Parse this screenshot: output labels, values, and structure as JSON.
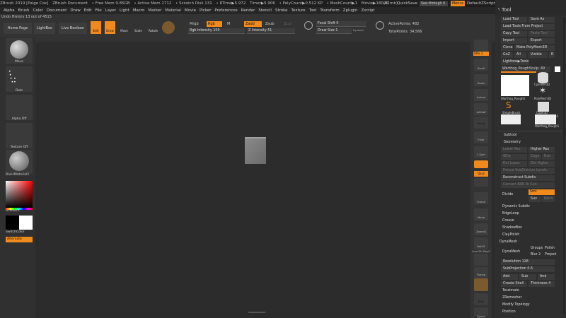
{
  "titlebar": {
    "app": "ZBrush 2019 [Paige Cox]",
    "doc": "ZBrush Document",
    "freemem": "• Free Mem 9.85GB",
    "activemem": "• Active Mem 1712",
    "scratch": "• Scratch Disk 131",
    "rtime": "• RTime▶5.972",
    "timer": "Timer▶5.906",
    "polycount": "• PolyCount▶0.512 KP",
    "meshcount": "• MeshCount▶1",
    "movie": "Movie▶180(31mb)",
    "ac": "AC",
    "quicksave": "QuickSave",
    "seethrough": "See-through 0",
    "menus": "Menus",
    "script": "DefaultZScript"
  },
  "menu": [
    "Alpha",
    "Brush",
    "Color",
    "Document",
    "Draw",
    "Edit",
    "File",
    "Layer",
    "Light",
    "Macro",
    "Marker",
    "Material",
    "Movie",
    "Picker",
    "Preferences",
    "Render",
    "Stencil",
    "Stroke",
    "Texture",
    "Tool",
    "Transform",
    "Zplugin",
    "Zscript"
  ],
  "undo": "Undo History 13 out of 4515",
  "top": {
    "home": "Home Page",
    "lightbox": "LightBox",
    "liveboolean": "Live Boolean",
    "edit": "Edit",
    "draw": "Draw",
    "move": "Move",
    "scale": "Scale",
    "rotate": "Rotate",
    "mrgb": "Mrgb",
    "rgb": "Rgb",
    "m": "M",
    "zadd": "Zadd",
    "zsub": "Zsub",
    "zcut": "Zcut",
    "rgbintensity": "Rgb Intensity 100",
    "zintensity": "Z Intensity 51",
    "focalshift": "Focal Shift 0",
    "drawsize": "Draw Size 1",
    "dynamic": "Dynamic",
    "activepoints": "ActivePoints: 482",
    "totalpoints": "TotalPoints: 34,566"
  },
  "left": {
    "brush": "Move",
    "stroke": "Dots",
    "alpha": "Alpha Off",
    "texture": "Texture Off",
    "material": "BasicMaterial2",
    "gradient": "Gradient",
    "switchcolor": "SwitchColor",
    "alternate": "Alternate"
  },
  "shelf": [
    "SPix 3",
    "Scroll",
    "Zoom",
    "Actual",
    "AAHalf",
    "Persp",
    "Floor",
    "L.Sym",
    "Qxyz",
    "",
    "",
    "Frame",
    "Move",
    "ZoomD",
    "RotYZ",
    "Line Fill PolyF",
    "Transp",
    "",
    "Solo",
    "Xpose"
  ],
  "tool": {
    "title": "Tool",
    "loadtool": "Load Tool",
    "saveas": "Save As",
    "loadfromproject": "Load Tools From Project",
    "copytool": "Copy Tool",
    "pastetool": "Paste Tool",
    "import": "Import",
    "export": "Export",
    "clone": "Clone",
    "makepolymesh": "Make PolyMesh3D",
    "goz": "GoZ",
    "all": "All",
    "visible": "Visible",
    "r": "R",
    "lightbox": "Lightbox▶Tools",
    "current": "Warthog_RoughSculp. 49",
    "thumbs": [
      "Warthog_RoughS",
      "PolyMesh3D",
      "SimpleBrush",
      "Cube3D",
      "Cylinder3D",
      "Warthog_RoughS"
    ],
    "count": "4",
    "subtool": "Subtool",
    "geometry": "Geometry",
    "lowerres": "Lower Res",
    "higherres": "Higher Res",
    "sdiv": "SDiv",
    "cage": "Cage",
    "rstr": "Rstr",
    "dellower": "Del Lower",
    "delhigher": "Del Higher",
    "freeze": "Freeze SubDivision Levels",
    "reconstruct": "Reconstruct Subdiv",
    "convertbpr": "Convert BPR To Geo",
    "divide": "Divide",
    "smt": "Smt",
    "suv": "Suv",
    "reuv": "ReUV",
    "dynamicsubdiv": "Dynamic Subdiv",
    "edgeloop": "EdgeLoop",
    "crease": "Crease",
    "shadowbox": "ShadowBox",
    "claypolish": "ClayPolish",
    "dynamesh": "DynaMesh",
    "dynameshbtn": "DynaMesh",
    "groups": "Groups",
    "polish": "Polish",
    "blur": "Blur 2",
    "project": "Project",
    "resolution": "Resolution 128",
    "subprojection": "SubProjection 0.6",
    "add": "Add",
    "sub": "Sub",
    "and": "And",
    "createshell": "Create Shell",
    "thickness": "Thickness 4",
    "tessimate": "Tessimate",
    "zremesher": "ZRemesher",
    "modifytopology": "Modify Topology",
    "position": "Position"
  },
  "colors": {
    "accent": "#f08a1c"
  }
}
